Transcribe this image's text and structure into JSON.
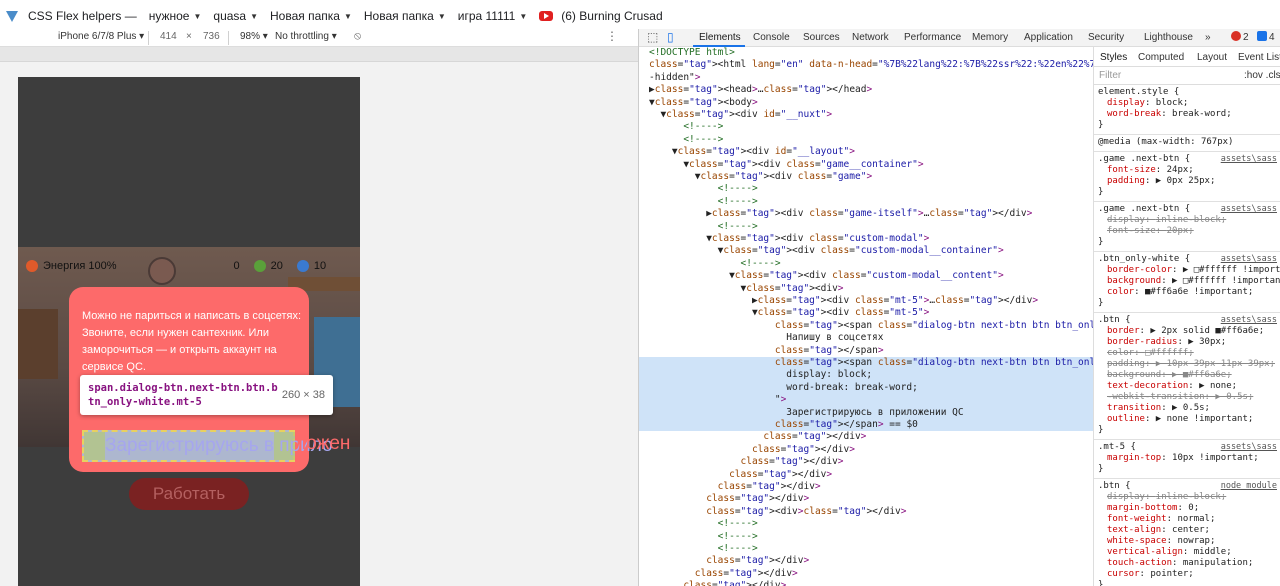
{
  "bookmarks": [
    {
      "label": "CSS Flex helpers —",
      "icon": "vue-icon",
      "folder": false
    },
    {
      "label": "нужное",
      "icon": "",
      "folder": true
    },
    {
      "label": "quasa",
      "icon": "",
      "folder": true
    },
    {
      "label": "Новая папка",
      "icon": "",
      "folder": true
    },
    {
      "label": "Новая папка",
      "icon": "",
      "folder": true
    },
    {
      "label": "игра 11111",
      "icon": "",
      "folder": true
    },
    {
      "label": "(6) Burning Crusad",
      "icon": "youtube-icon",
      "folder": false
    }
  ],
  "device_toolbar": {
    "device": "iPhone 6/7/8 Plus ▾",
    "width": "414",
    "times": "×",
    "height": "736",
    "zoom": "98% ▾",
    "throttling": "No throttling ▾"
  },
  "game": {
    "energy": "Энергия 100%",
    "stat1": "0",
    "stat2": "20",
    "stat3": "10",
    "work_button": "Работать"
  },
  "modal": {
    "text": "Можно не париться и написать в соцсетях: Звоните, если нужен сантехник. Или заморочиться — и открыть аккаунт на сервисе QC.",
    "button_label_visible": "Зарегистрируюсь в прило",
    "button_label_overflow": "ложен"
  },
  "tooltip": {
    "selector": "span.dialog-btn.next-btn.btn.btn_only-white.mt-5",
    "dims": "260 × 38"
  },
  "devtools": {
    "tabs": [
      "Elements",
      "Console",
      "Sources",
      "Network",
      "Performance",
      "Memory",
      "Application",
      "Security",
      "Lighthouse",
      "»"
    ],
    "errors": "2",
    "messages": "4",
    "styles_tabs": [
      "Styles",
      "Computed",
      "Layout",
      "Event Listeners"
    ],
    "filter_placeholder": "Filter",
    "filter_buttons": ":hov  .cls"
  },
  "dom_lines": [
    "<!DOCTYPE html>",
    "<html lang=\"en\" data-n-head=\"%7B%22lang%22:%7B%22ssr%22:%22en%22%7D%7D\" class=\"overflow-y-",
    "-hidden\">",
    "▶<head>…</head>",
    "▼<body>",
    "  ▼<div id=\"__nuxt\">",
    "      <!---->",
    "      <!---->",
    "    ▼<div id=\"__layout\">",
    "      ▼<div class=\"game__container\">",
    "        ▼<div class=\"game\">",
    "            <!---->",
    "            <!---->",
    "          ▶<div class=\"game-itself\">…</div>",
    "            <!---->",
    "          ▼<div class=\"custom-modal\">",
    "            ▼<div class=\"custom-modal__container\">",
    "                <!---->",
    "              ▼<div class=\"custom-modal__content\">",
    "                ▼<div>",
    "                  ▶<div class=\"mt-5\">…</div>",
    "                  ▼<div class=\"mt-5\">",
    "                      <span class=\"dialog-btn next-btn btn btn_only-white mt-5\">",
    "                        Напишу в соцсетях",
    "                      </span>",
    "                      <span class=\"dialog-btn next-btn btn btn_only-white mt-5\" style=\"",
    "                        display: block;",
    "                        word-break: break-word;",
    "                      \">",
    "                        Зарегистрируюсь в приложении QC",
    "                      </span> == $0",
    "                    </div>",
    "                  </div>",
    "                </div>",
    "              </div>",
    "            </div>",
    "          </div>",
    "          <div></div>",
    "            <!---->",
    "            <!---->",
    "            <!---->",
    "          </div>",
    "        </div>",
    "      </div>",
    "    </div>"
  ],
  "css_rules": [
    {
      "selector": "element.style {",
      "src": "",
      "props": [
        [
          "display",
          "block;",
          false
        ],
        [
          "word-break",
          "break-word;",
          false
        ]
      ]
    },
    {
      "selector": "@media (max-width: 767px)",
      "src": "",
      "props": []
    },
    {
      "selector": ".game .next-btn {",
      "src": "assets\\sass",
      "props": [
        [
          "font-size",
          "24px;",
          false
        ],
        [
          "padding",
          "▶ 0px 25px;",
          false
        ]
      ]
    },
    {
      "selector": ".game .next-btn {",
      "src": "assets\\sass",
      "props": [
        [
          "display",
          "inline-block;",
          true
        ],
        [
          "font-size",
          "20px;",
          true
        ]
      ]
    },
    {
      "selector": ".btn_only-white {",
      "src": "assets\\sass",
      "props": [
        [
          "border-color",
          "▶ □#ffffff !important;",
          false
        ],
        [
          "background",
          "▶ □#ffffff !important;",
          false
        ],
        [
          "color",
          "■#ff6a6e !important;",
          false
        ]
      ]
    },
    {
      "selector": ".btn {",
      "src": "assets\\sass",
      "props": [
        [
          "border",
          "▶ 2px solid ■#ff6a6e;",
          false
        ],
        [
          "border-radius",
          "▶ 30px;",
          false
        ],
        [
          "color",
          "□#ffffff;",
          true
        ],
        [
          "padding",
          "▶ 10px 39px 11px 39px;",
          true
        ],
        [
          "background",
          "▶ ■#ff6a6e;",
          true
        ],
        [
          "text-decoration",
          "▶ none;",
          false
        ],
        [
          "-webkit-transition",
          "▶ 0.5s;",
          true
        ],
        [
          "transition",
          "▶ 0.5s;",
          false
        ],
        [
          "outline",
          "▶ none !important;",
          false
        ]
      ]
    },
    {
      "selector": ".mt-5 {",
      "src": "assets\\sass",
      "props": [
        [
          "margin-top",
          "10px !important;",
          false
        ]
      ]
    },
    {
      "selector": ".btn {",
      "src": "node_module",
      "props": [
        [
          "display",
          "inline-block;",
          true
        ],
        [
          "margin-bottom",
          "0;",
          false
        ],
        [
          "font-weight",
          "normal;",
          false
        ],
        [
          "text-align",
          "center;",
          false
        ],
        [
          "white-space",
          "nowrap;",
          false
        ],
        [
          "vertical-align",
          "middle;",
          false
        ],
        [
          "touch-action",
          "manipulation;",
          false
        ],
        [
          "cursor",
          "pointer;",
          false
        ]
      ]
    }
  ],
  "colors": {
    "modal_bg": "#fd6a6a",
    "selection": "#cfe3f8",
    "accent": "#1a73e8"
  }
}
